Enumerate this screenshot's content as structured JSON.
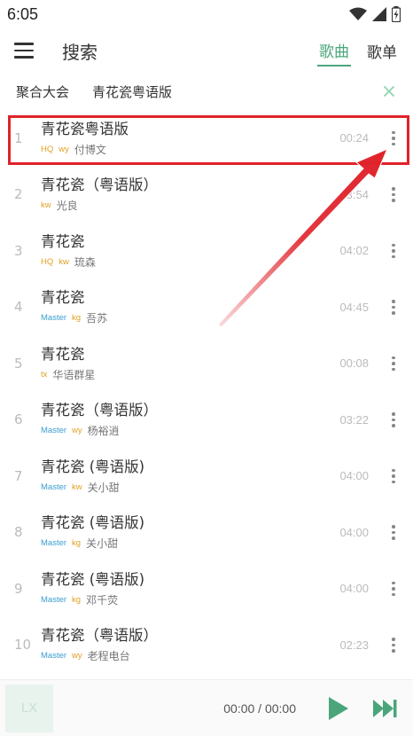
{
  "status": {
    "time": "6:05"
  },
  "header": {
    "title": "搜索",
    "tabs": [
      {
        "label": "歌曲",
        "active": true
      },
      {
        "label": "歌单",
        "active": false
      }
    ]
  },
  "filter": {
    "source": "聚合大会",
    "query": "青花瓷粤语版"
  },
  "colors": {
    "accent": "#4aa67a",
    "highlight": "#e0222a",
    "quality": "#e0a122",
    "master": "#3a9fd0"
  },
  "songs": [
    {
      "index": "1",
      "name": "青花瓷粤语版",
      "quality": "HQ",
      "source": "wy",
      "singer": "付博文",
      "duration": "00:24"
    },
    {
      "index": "2",
      "name": "青花瓷（粤语版）",
      "quality": "",
      "source": "kw",
      "singer": "光良",
      "duration": "03:54"
    },
    {
      "index": "3",
      "name": "青花瓷",
      "quality": "HQ",
      "source": "kw",
      "singer": "琉森",
      "duration": "04:02"
    },
    {
      "index": "4",
      "name": "青花瓷",
      "quality": "Master",
      "source": "kg",
      "singer": "吾苏",
      "duration": "04:45"
    },
    {
      "index": "5",
      "name": "青花瓷",
      "quality": "",
      "source": "tx",
      "singer": "华语群星",
      "duration": "00:08"
    },
    {
      "index": "6",
      "name": "青花瓷（粤语版）",
      "quality": "Master",
      "source": "wy",
      "singer": "杨裕逍",
      "duration": "03:22"
    },
    {
      "index": "7",
      "name": "青花瓷 (粤语版)",
      "quality": "Master",
      "source": "kw",
      "singer": "关小甜",
      "duration": "04:00"
    },
    {
      "index": "8",
      "name": "青花瓷 (粤语版)",
      "quality": "Master",
      "source": "kg",
      "singer": "关小甜",
      "duration": "04:00"
    },
    {
      "index": "9",
      "name": "青花瓷 (粤语版)",
      "quality": "Master",
      "source": "kg",
      "singer": "邓千荧",
      "duration": "04:00"
    },
    {
      "index": "10",
      "name": "青花瓷（粤语版）",
      "quality": "Master",
      "source": "wy",
      "singer": "老程电台",
      "duration": "02:23"
    }
  ],
  "player": {
    "cover_text": "LX",
    "progress": "00:00 / 00:00"
  }
}
